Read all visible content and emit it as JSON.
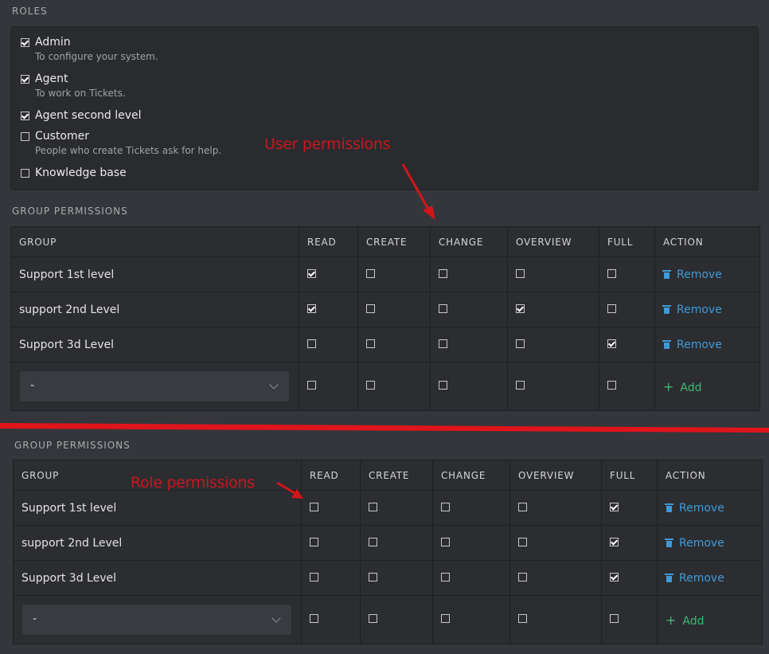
{
  "roles": {
    "label": "ROLES",
    "items": [
      {
        "name": "Admin",
        "desc": "To configure your system.",
        "checked": true
      },
      {
        "name": "Agent",
        "desc": "To work on Tickets.",
        "checked": true
      },
      {
        "name": "Agent second level",
        "desc": "",
        "checked": true
      },
      {
        "name": "Customer",
        "desc": "People who create Tickets ask for help.",
        "checked": false
      },
      {
        "name": "Knowledge base",
        "desc": "",
        "checked": false
      }
    ]
  },
  "annotations": {
    "user": "User permissions",
    "role": "Role permissions"
  },
  "colors": {
    "annotation": "#c9161c",
    "remove": "#3f9ad8",
    "add": "#3fb870",
    "background": "#35363b",
    "panel": "#2c2d31"
  },
  "tables": [
    {
      "label": "GROUP PERMISSIONS",
      "headers": [
        "GROUP",
        "READ",
        "CREATE",
        "CHANGE",
        "OVERVIEW",
        "FULL",
        "ACTION"
      ],
      "rows": [
        {
          "group": "Support 1st level",
          "perms": [
            true,
            false,
            false,
            false,
            false
          ],
          "action": "Remove"
        },
        {
          "group": "support 2nd Level",
          "perms": [
            true,
            false,
            false,
            true,
            false
          ],
          "action": "Remove"
        },
        {
          "group": "Support 3d Level",
          "perms": [
            false,
            false,
            false,
            false,
            true
          ],
          "action": "Remove"
        }
      ],
      "new_row": {
        "select_value": "-",
        "perms": [
          false,
          false,
          false,
          false,
          false
        ],
        "action": "Add"
      }
    },
    {
      "label": "GROUP PERMISSIONS",
      "headers": [
        "GROUP",
        "READ",
        "CREATE",
        "CHANGE",
        "OVERVIEW",
        "FULL",
        "ACTION"
      ],
      "rows": [
        {
          "group": "Support 1st level",
          "perms": [
            false,
            false,
            false,
            false,
            true
          ],
          "action": "Remove"
        },
        {
          "group": "support 2nd Level",
          "perms": [
            false,
            false,
            false,
            false,
            true
          ],
          "action": "Remove"
        },
        {
          "group": "Support 3d Level",
          "perms": [
            false,
            false,
            false,
            false,
            true
          ],
          "action": "Remove"
        }
      ],
      "new_row": {
        "select_value": "-",
        "perms": [
          false,
          false,
          false,
          false,
          false
        ],
        "action": "Add"
      }
    }
  ],
  "icons": [
    "trash-icon",
    "plus-icon",
    "chevron-down-icon",
    "checkbox-icon"
  ]
}
